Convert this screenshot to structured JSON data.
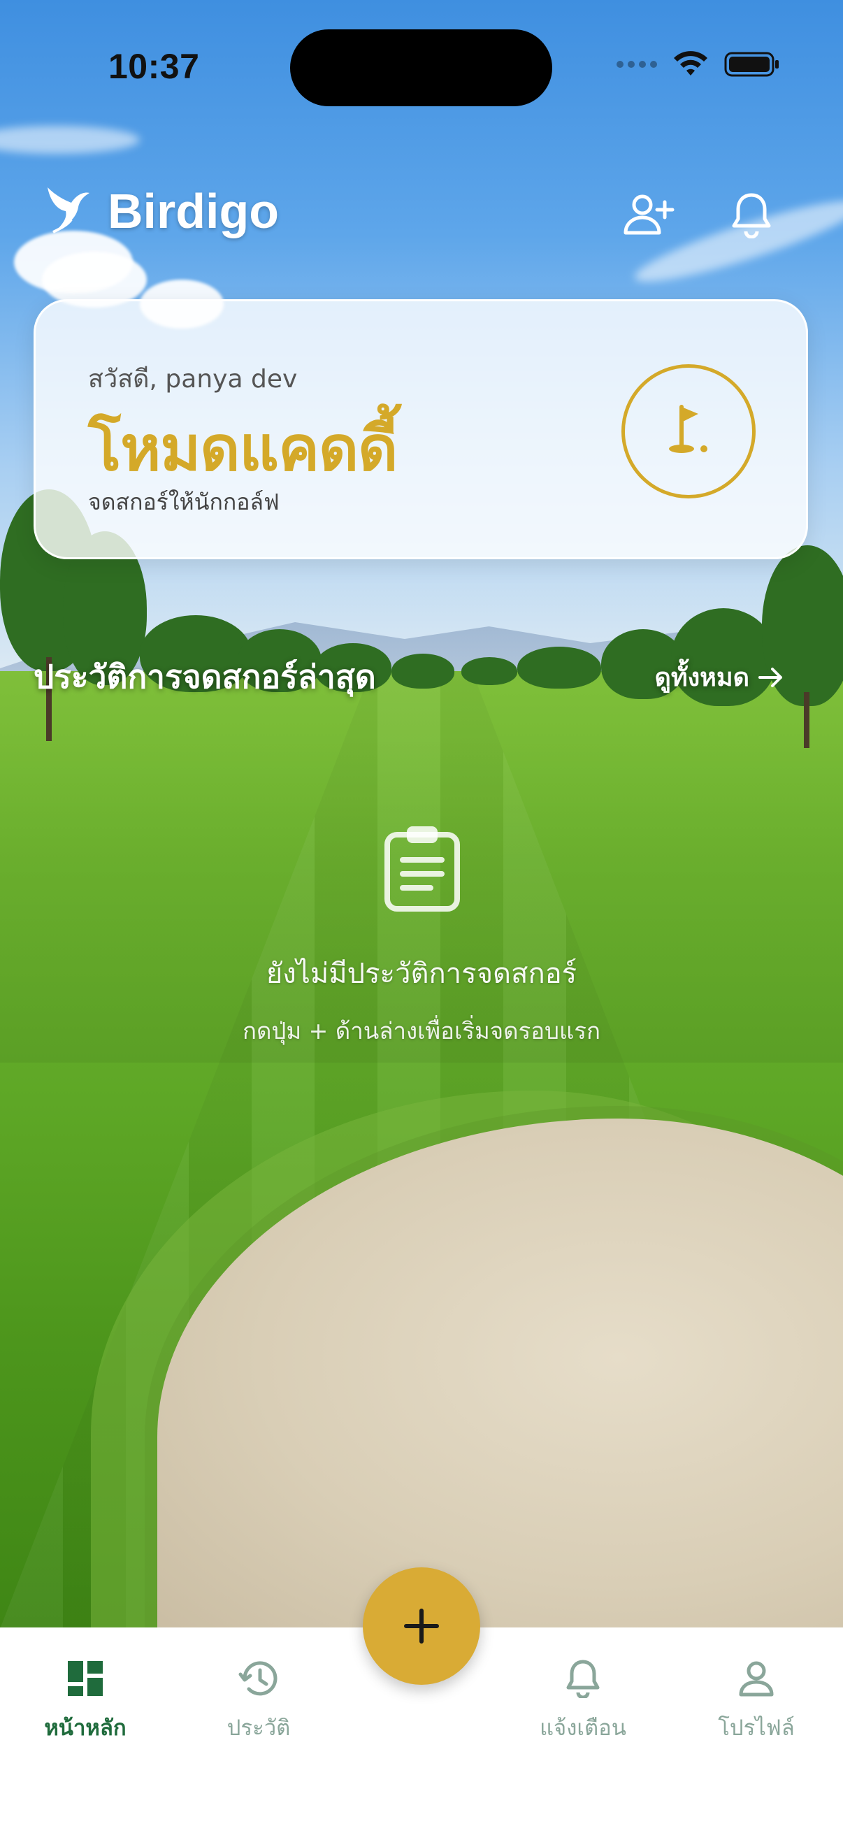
{
  "status_bar": {
    "time": "10:37"
  },
  "header": {
    "app_name": "Birdigo"
  },
  "caddy_card": {
    "greeting": "สวัสดี, panya dev",
    "title": "โหมดแคดดี้",
    "subtitle": "จดสกอร์ให้นักกอล์ฟ"
  },
  "history": {
    "title": "ประวัติการจดสกอร์ล่าสุด",
    "see_all": "ดูทั้งหมด",
    "empty_title": "ยังไม่มีประวัติการจดสกอร์",
    "empty_subtitle": "กดปุ่ม + ด้านล่างเพื่อเริ่มจดรอบแรก"
  },
  "nav": {
    "items": [
      {
        "label": "หน้าหลัก",
        "icon": "dashboard-icon",
        "active": true
      },
      {
        "label": "ประวัติ",
        "icon": "history-icon",
        "active": false
      },
      {
        "label": "แจ้งเตือน",
        "icon": "bell-icon",
        "active": false
      },
      {
        "label": "โปรไฟล์",
        "icon": "person-icon",
        "active": false
      }
    ],
    "fab_icon": "plus-icon"
  },
  "colors": {
    "accent_gold": "#d4a929",
    "fab": "#d9ab35",
    "nav_active": "#1f6b3c",
    "nav_inactive": "#8aa69a"
  }
}
